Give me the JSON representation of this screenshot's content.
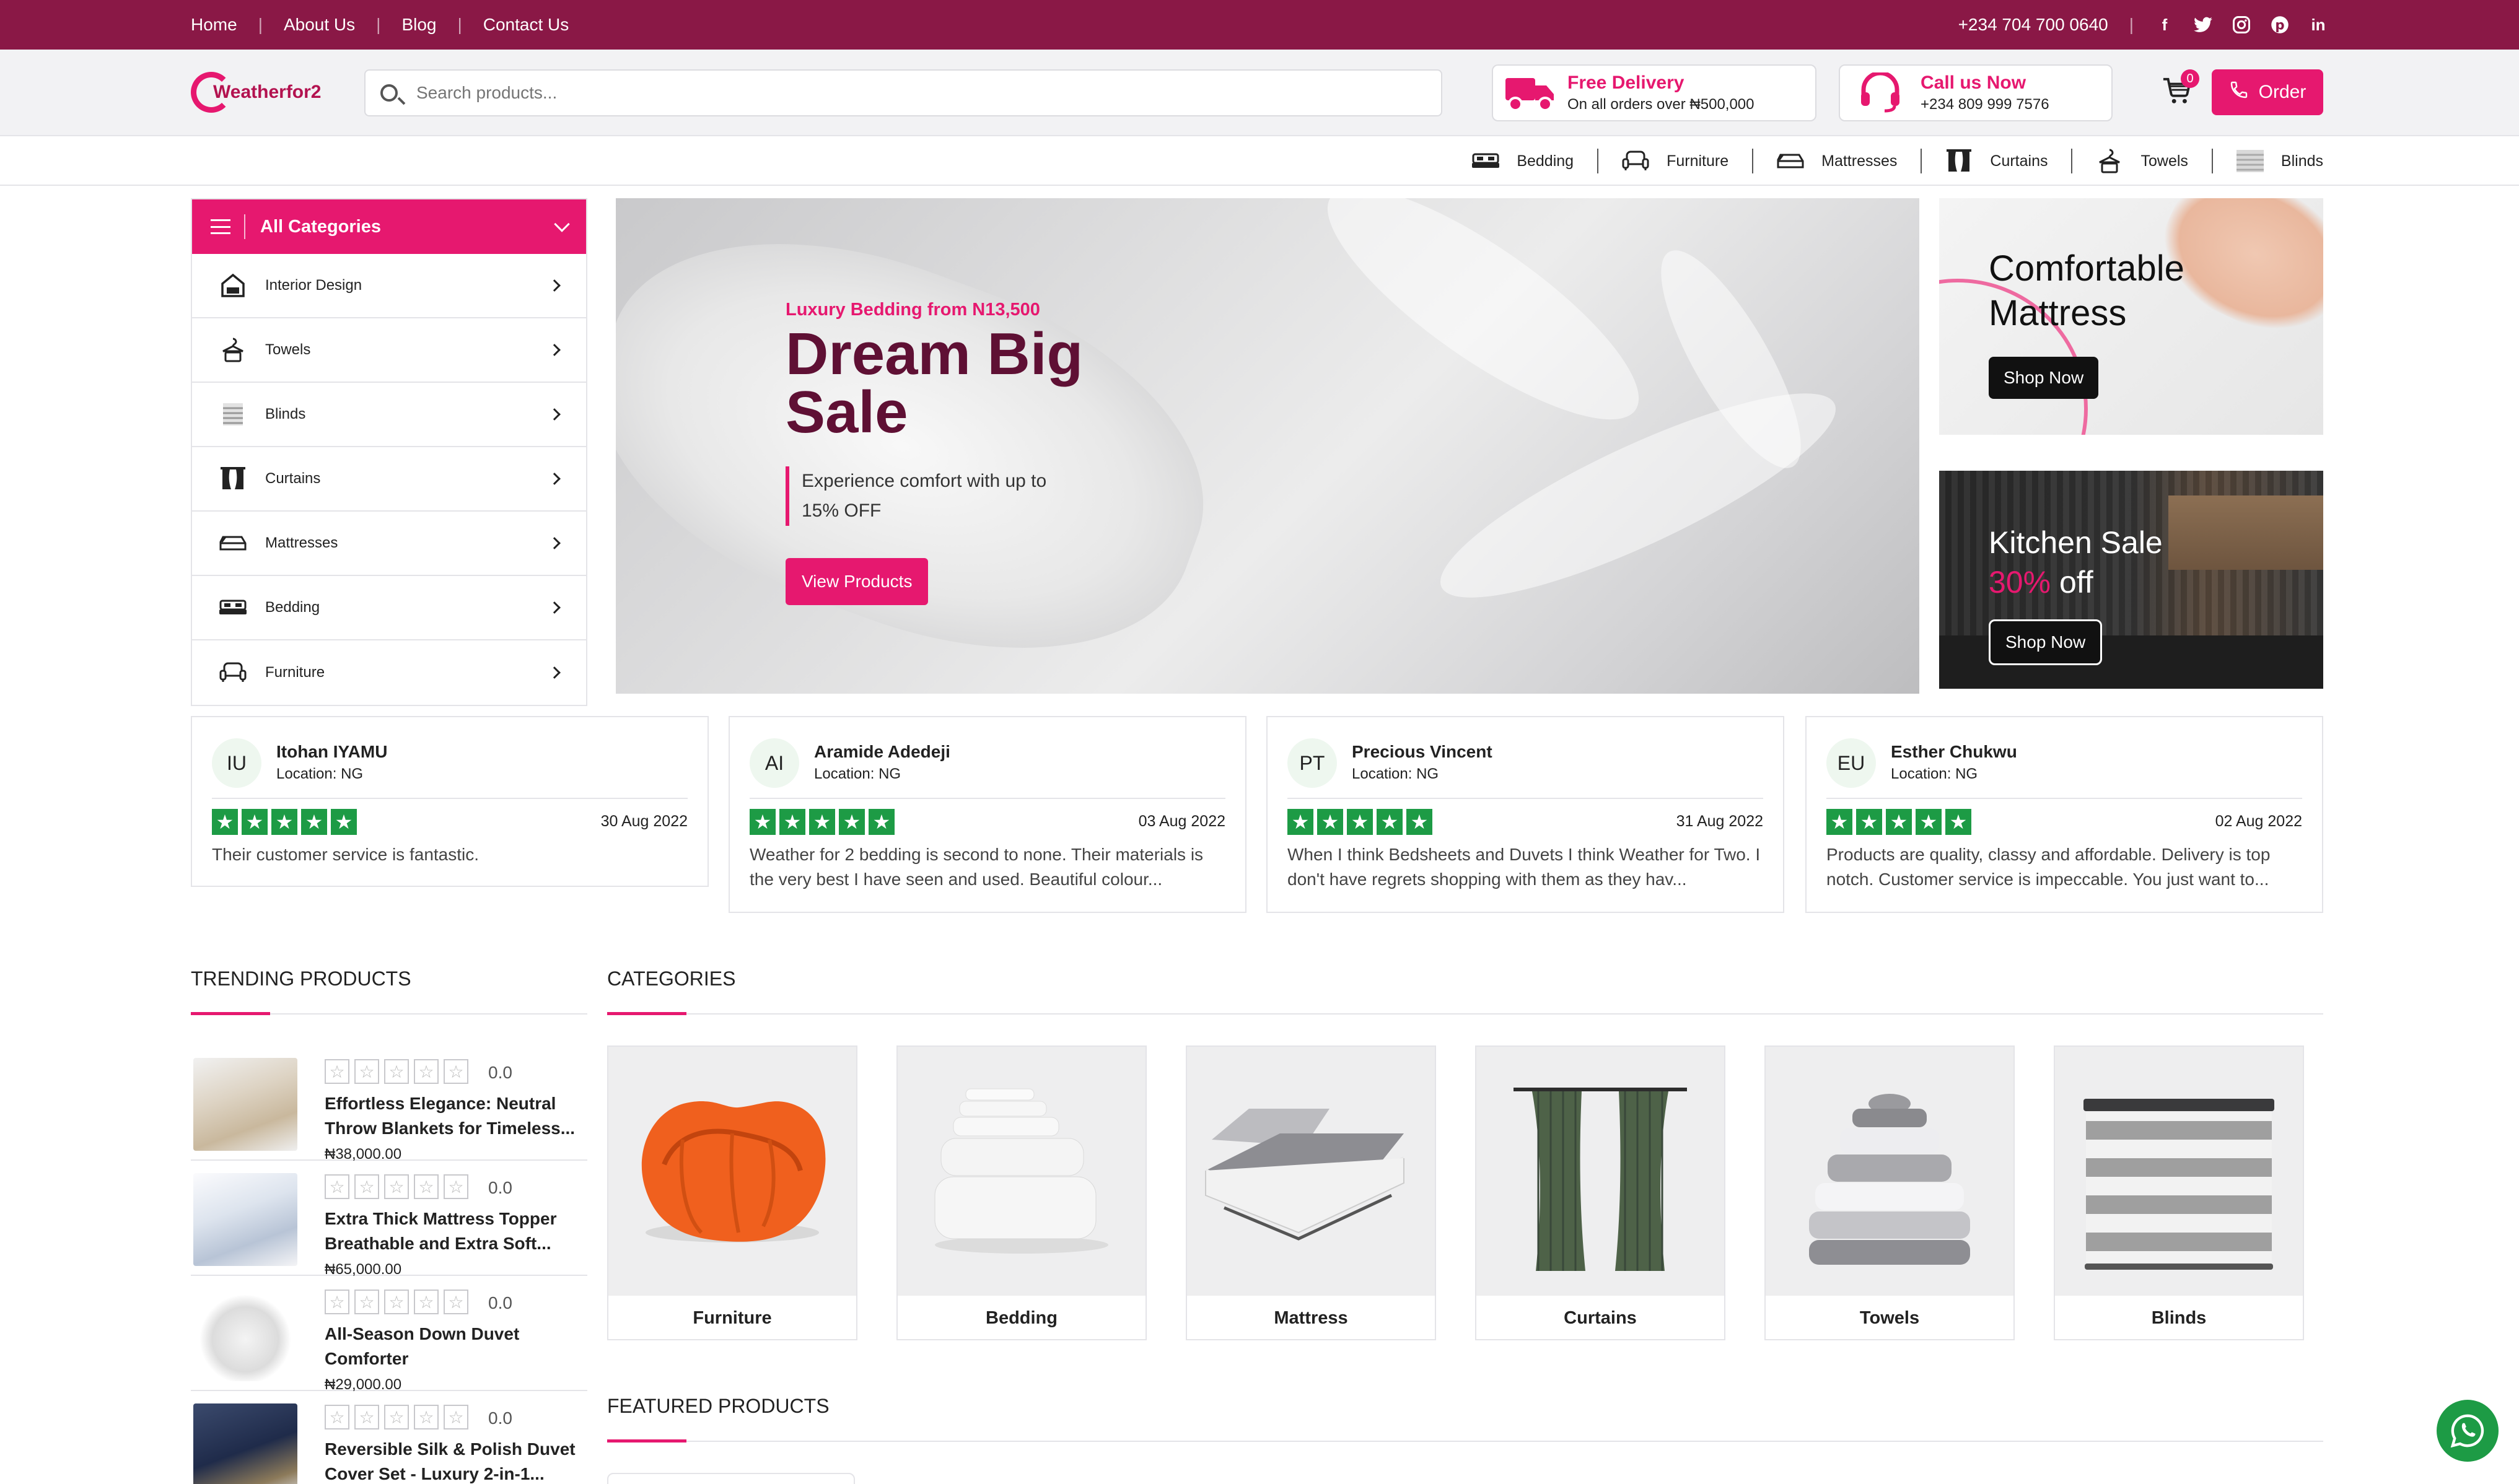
{
  "topbar": {
    "nav": [
      "Home",
      "About Us",
      "Blog",
      "Contact Us"
    ],
    "phone": "+234 704 700 0640",
    "social_icons": [
      "facebook-icon",
      "twitter-icon",
      "instagram-icon",
      "pinterest-icon",
      "linkedin-icon"
    ]
  },
  "header": {
    "logo_text": "Weatherfor2",
    "search_placeholder": "Search products...",
    "delivery_title": "Free Delivery",
    "delivery_sub": "On all orders over ₦500,000",
    "call_title": "Call us Now",
    "call_sub": "+234 809 999 7576",
    "cart_count": "0",
    "order_label": "Order"
  },
  "catnav": [
    "Bedding",
    "Furniture",
    "Mattresses",
    "Curtains",
    "Towels",
    "Blinds"
  ],
  "sidebar": {
    "title": "All Categories",
    "items": [
      "Interior Design",
      "Towels",
      "Blinds",
      "Curtains",
      "Mattresses",
      "Bedding",
      "Furniture"
    ]
  },
  "hero": {
    "subtitle": "Luxury Bedding from N13,500",
    "title_line1": "Dream Big",
    "title_line2": "Sale",
    "desc_line1": "Experience comfort with up to",
    "desc_line2": "15% OFF",
    "button": "View Products"
  },
  "promo1": {
    "line1": "Comfortable",
    "line2": "Mattress",
    "button": "Shop Now"
  },
  "promo2": {
    "line1": "Kitchen Sale",
    "pct": "30%",
    "off": " off",
    "button": "Shop Now"
  },
  "reviews": [
    {
      "initials": "IU",
      "name": "Itohan IYAMU",
      "location": "Location: NG",
      "date": "30 Aug 2022",
      "text": "Their customer service is fantastic.",
      "rating": 5
    },
    {
      "initials": "AI",
      "name": "Aramide Adedeji",
      "location": "Location: NG",
      "date": "03 Aug 2022",
      "text": "Weather for 2 bedding is second to none. Their materials is the very best I have seen and used. Beautiful colour...",
      "rating": 5
    },
    {
      "initials": "PT",
      "name": "Precious Vincent",
      "location": "Location: NG",
      "date": "31 Aug 2022",
      "text": "When I think Bedsheets and Duvets I think Weather for Two. I don't have regrets shopping with them as they hav...",
      "rating": 5
    },
    {
      "initials": "EU",
      "name": "Esther Chukwu",
      "location": "Location: NG",
      "date": "02 Aug 2022",
      "text": "Products are quality, classy and affordable. Delivery is top notch. Customer service is impeccable. You just want to...",
      "rating": 5
    }
  ],
  "sections": {
    "trending": "TRENDING PRODUCTS",
    "categories": "CATEGORIES",
    "featured": "FEATURED PRODUCTS"
  },
  "trending": [
    {
      "name": "Effortless Elegance: Neutral Throw Blankets for Timeless...",
      "price": "₦38,000.00",
      "rating": "0.0"
    },
    {
      "name": "Extra Thick Mattress Topper Breathable and Extra Soft...",
      "price": "₦65,000.00",
      "rating": "0.0"
    },
    {
      "name": "All-Season Down Duvet Comforter",
      "price": "₦29,000.00",
      "rating": "0.0"
    },
    {
      "name": "Reversible Silk & Polish Duvet Cover Set - Luxury 2-in-1...",
      "price": "",
      "rating": "0.0"
    }
  ],
  "categories": [
    "Furniture",
    "Bedding",
    "Mattress",
    "Curtains",
    "Towels",
    "Blinds"
  ],
  "colors": {
    "brand": "#8a1846",
    "accent": "#e6186f",
    "star": "#1d9b45"
  }
}
